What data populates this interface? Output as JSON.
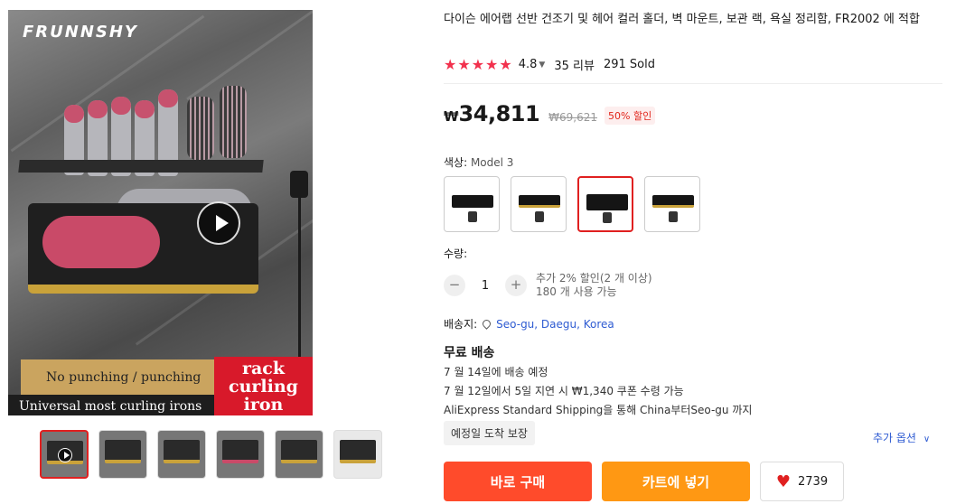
{
  "media": {
    "brand_logo_text": "FRUNNSHY",
    "banner_left_1": "No punching / punching",
    "banner_left_2": "Universal most curling irons",
    "banner_right": [
      "rack",
      "curling",
      "iron"
    ]
  },
  "product": {
    "title": "다이슨 에어랩 선반 건조기 및 헤어 컬러 홀더, 벽 마운트, 보관 랙, 욕실 정리함, FR2002 에 적합",
    "rating": "4.8",
    "reviews": "35 리뷰",
    "sold": "291 Sold"
  },
  "price": {
    "currency": "₩",
    "current": "34,811",
    "original": "₩69,621",
    "discount": "50% 할인"
  },
  "color": {
    "label": "색상: ",
    "selected": "Model 3",
    "selected_index": 2,
    "options_count": 4
  },
  "quantity": {
    "label": "수량:",
    "value": "1",
    "minus": "−",
    "plus": "+",
    "note_1": "추가 2% 할인(2 개 이상)",
    "note_2": "180 개 사용 가능"
  },
  "shipping": {
    "ship_to_label": "배송지:",
    "location": "Seo-gu, Daegu, Korea",
    "free": "무료 배송",
    "eta": "7 월 14일에 배송 예정",
    "delay_coupon": "7 월 12일에서 5일 지연 시 ₩1,340 쿠폰 수령 가능",
    "method": "AliExpress Standard Shipping을 통해 China부터Seo-gu 까지",
    "guarantee": "예정일 도착 보장",
    "more_options": "추가 옵션"
  },
  "actions": {
    "buy_now": "바로 구매",
    "add_to_cart": "카트에 넣기",
    "wishlist_count": "2739"
  },
  "colors": {
    "accent_red": "#f2314d",
    "buy_now": "#ff4b2b",
    "add_to_cart": "#ff9813",
    "link_blue": "#2e5bd2"
  },
  "icons": [
    "play-icon",
    "star-icon",
    "chevron-down-icon",
    "location-pin-icon",
    "heart-icon"
  ]
}
